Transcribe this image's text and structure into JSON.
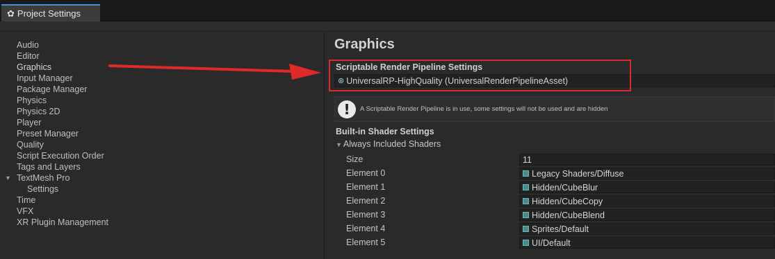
{
  "window": {
    "tab_title": "Project Settings",
    "tab_icon": "gear-icon"
  },
  "sidebar": {
    "items": [
      {
        "label": "Audio"
      },
      {
        "label": "Editor"
      },
      {
        "label": "Graphics"
      },
      {
        "label": "Input Manager"
      },
      {
        "label": "Package Manager"
      },
      {
        "label": "Physics"
      },
      {
        "label": "Physics 2D"
      },
      {
        "label": "Player"
      },
      {
        "label": "Preset Manager"
      },
      {
        "label": "Quality"
      },
      {
        "label": "Script Execution Order"
      },
      {
        "label": "Tags and Layers"
      },
      {
        "label": "TextMesh Pro"
      },
      {
        "label": "Settings"
      },
      {
        "label": "Time"
      },
      {
        "label": "VFX"
      },
      {
        "label": "XR Plugin Management"
      }
    ],
    "selected": "Graphics",
    "annotation_arrow_color": "#e02a2a"
  },
  "main": {
    "title": "Graphics",
    "srp": {
      "header": "Scriptable Render Pipeline Settings",
      "asset_value": "UniversalRP-HighQuality (UniversalRenderPipelineAsset)",
      "highlight_color": "#e02a2a"
    },
    "help_message": "A Scriptable Render Pipeline is in use, some settings will not be used and are hidden",
    "builtin_shader_header": "Built-in Shader Settings",
    "always_included": {
      "label": "Always Included Shaders",
      "size_label": "Size",
      "size_value": "11",
      "elements": [
        {
          "label": "Element 0",
          "value": "Legacy Shaders/Diffuse"
        },
        {
          "label": "Element 1",
          "value": "Hidden/CubeBlur"
        },
        {
          "label": "Element 2",
          "value": "Hidden/CubeCopy"
        },
        {
          "label": "Element 3",
          "value": "Hidden/CubeBlend"
        },
        {
          "label": "Element 4",
          "value": "Sprites/Default"
        },
        {
          "label": "Element 5",
          "value": "UI/Default"
        }
      ]
    }
  }
}
